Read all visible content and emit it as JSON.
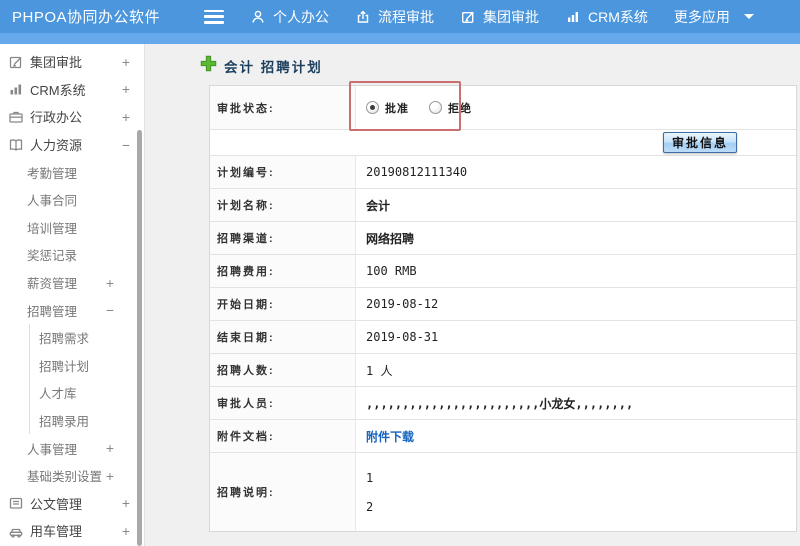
{
  "header": {
    "logo": "PHPOA协同办公软件",
    "nav": [
      {
        "label": "个人办公",
        "icon": "user-icon"
      },
      {
        "label": "流程审批",
        "icon": "share-icon"
      },
      {
        "label": "集团审批",
        "icon": "edit-icon"
      },
      {
        "label": "CRM系统",
        "icon": "chart-icon"
      },
      {
        "label": "更多应用",
        "icon": "caret-down-icon"
      }
    ]
  },
  "sidebar": {
    "items": [
      {
        "label": "集团审批",
        "toggle": "+",
        "icon": "edit-square-icon"
      },
      {
        "label": "CRM系统",
        "toggle": "+",
        "icon": "bar-chart-icon"
      },
      {
        "label": "行政办公",
        "toggle": "+",
        "icon": "briefcase-icon"
      },
      {
        "label": "人力资源",
        "toggle": "−",
        "icon": "book-icon"
      },
      {
        "label": "考勤管理"
      },
      {
        "label": "人事合同"
      },
      {
        "label": "培训管理"
      },
      {
        "label": "奖惩记录"
      },
      {
        "label": "薪资管理",
        "toggle": "+"
      },
      {
        "label": "招聘管理",
        "toggle": "−"
      },
      {
        "label": "招聘需求"
      },
      {
        "label": "招聘计划"
      },
      {
        "label": "人才库"
      },
      {
        "label": "招聘录用"
      },
      {
        "label": "人事管理",
        "toggle": "+"
      },
      {
        "label": "基础类别设置",
        "toggle": "+"
      },
      {
        "label": "公文管理",
        "toggle": "+",
        "icon": "document-icon"
      },
      {
        "label": "用车管理",
        "toggle": "+",
        "icon": "car-icon"
      }
    ]
  },
  "main": {
    "title": "会计 招聘计划",
    "status_row": {
      "label": "审批状态:",
      "options": [
        {
          "label": "批准",
          "selected": true
        },
        {
          "label": "拒绝",
          "selected": false
        }
      ]
    },
    "approve_button": "审批信息",
    "rows": [
      {
        "label": "计划编号:",
        "value": "20190812111340"
      },
      {
        "label": "计划名称:",
        "value": "会计"
      },
      {
        "label": "招聘渠道:",
        "value": "网络招聘"
      },
      {
        "label": "招聘费用:",
        "value": "100 RMB"
      },
      {
        "label": "开始日期:",
        "value": "2019-08-12"
      },
      {
        "label": "结束日期:",
        "value": "2019-08-31"
      },
      {
        "label": "招聘人数:",
        "value": "1 人"
      },
      {
        "label": "审批人员:",
        "value": ",,,,,,,,,,,,,,,,,,,,,,,,小龙女,,,,,,,,"
      },
      {
        "label": "附件文档:",
        "value": "附件下载"
      },
      {
        "label": "招聘说明:",
        "value1": "1",
        "value2": "2"
      }
    ]
  },
  "colors": {
    "header_blue": "#4b96dc",
    "header_strip": "#65a9ea",
    "accent_green": "#5cb832",
    "link_blue": "#1464c0",
    "annotation_red": "#c96f6f"
  }
}
